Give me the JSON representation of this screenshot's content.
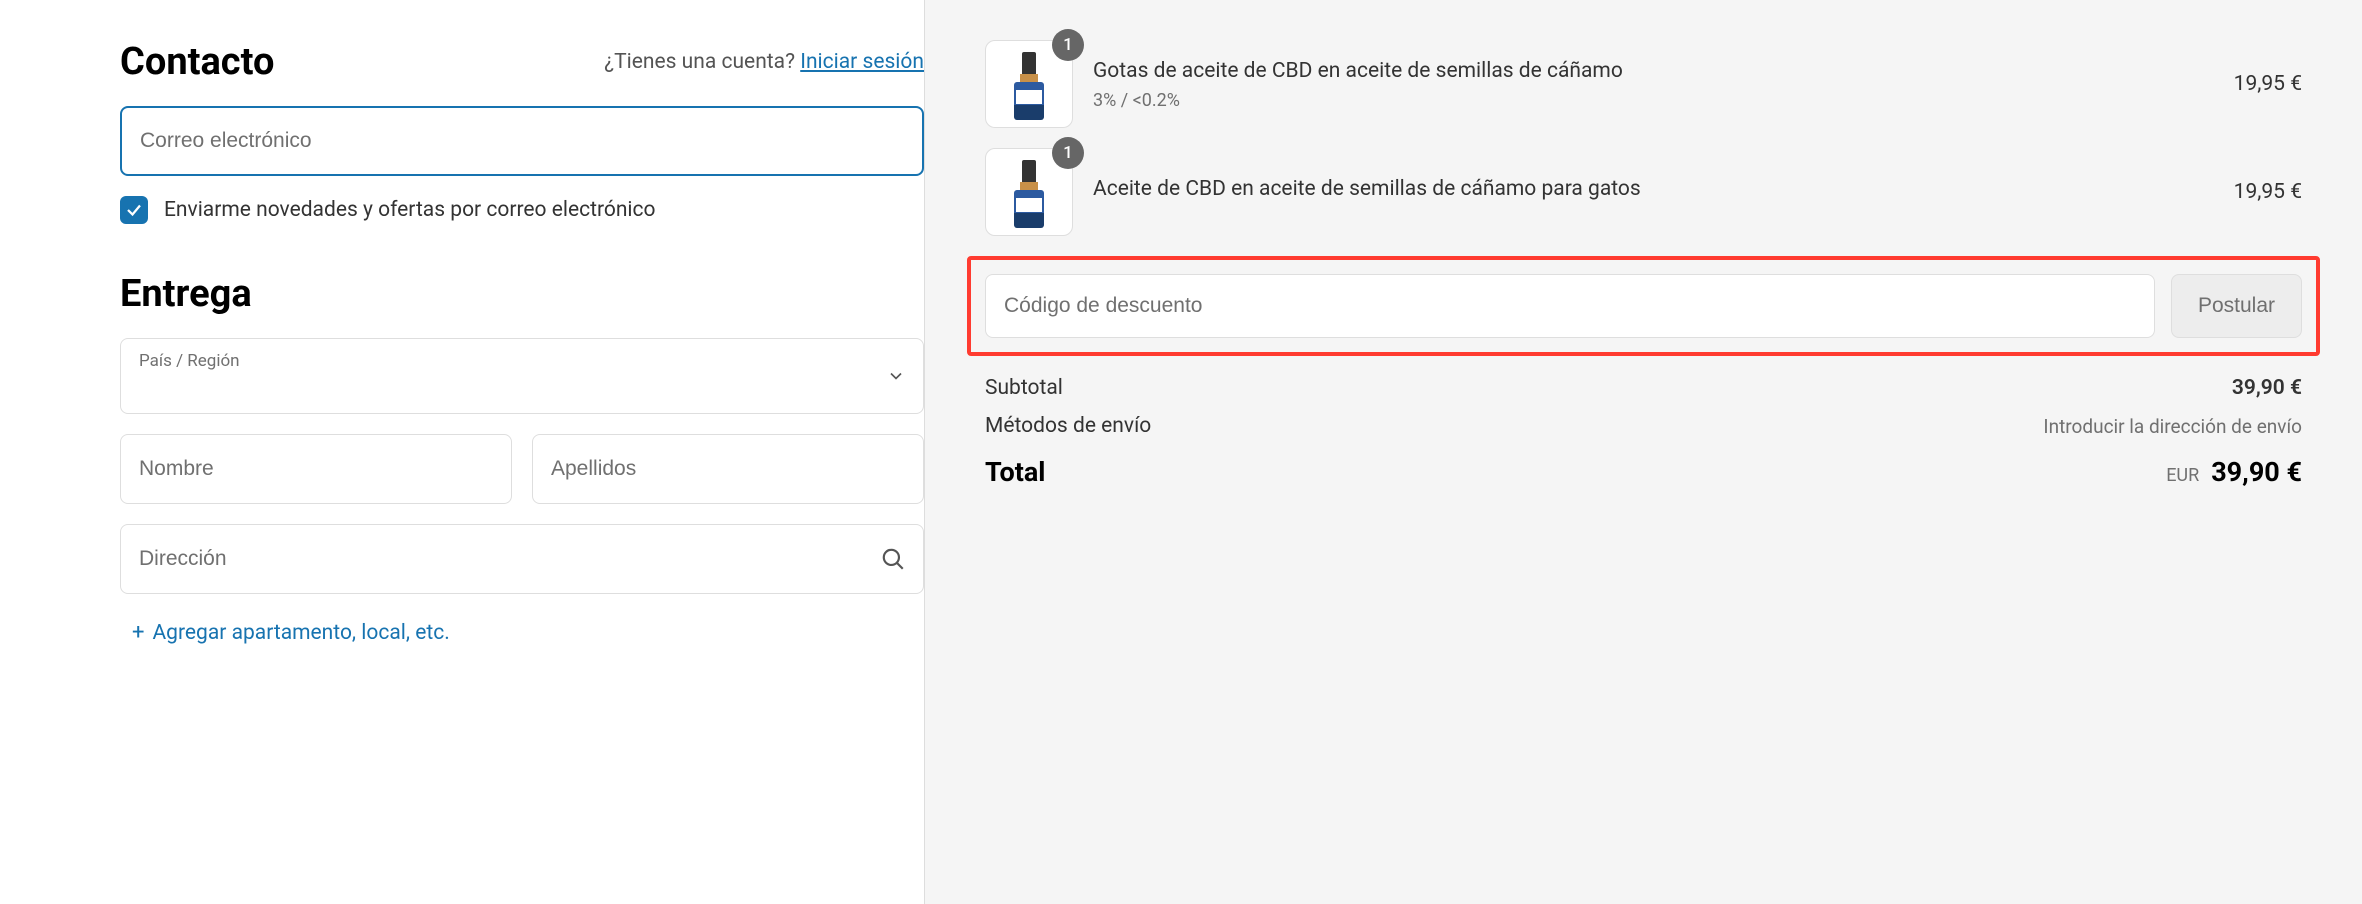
{
  "contact": {
    "heading": "Contacto",
    "account_prompt": "¿Tienes una cuenta?",
    "login_link": "Iniciar sesión",
    "email_placeholder": "Correo electrónico",
    "newsletter_label": "Enviarme novedades y ofertas por correo electrónico"
  },
  "delivery": {
    "heading": "Entrega",
    "country_label": "País / Región",
    "first_name_placeholder": "Nombre",
    "last_name_placeholder": "Apellidos",
    "address_placeholder": "Dirección",
    "add_apartment": "Agregar apartamento, local, etc.",
    "plus": "+"
  },
  "cart": {
    "items": [
      {
        "qty": "1",
        "title": "Gotas de aceite de CBD en aceite de semillas de cáñamo",
        "variant": "3% / <0.2%",
        "price": "19,95 €"
      },
      {
        "qty": "1",
        "title": "Aceite de CBD en aceite de semillas de cáñamo para gatos",
        "variant": "",
        "price": "19,95 €"
      }
    ],
    "discount_placeholder": "Código de descuento",
    "apply_label": "Postular",
    "subtotal_label": "Subtotal",
    "subtotal_value": "39,90 €",
    "shipping_label": "Métodos de envío",
    "shipping_note": "Introducir la dirección de envío",
    "total_label": "Total",
    "currency": "EUR",
    "total_value": "39,90 €"
  }
}
